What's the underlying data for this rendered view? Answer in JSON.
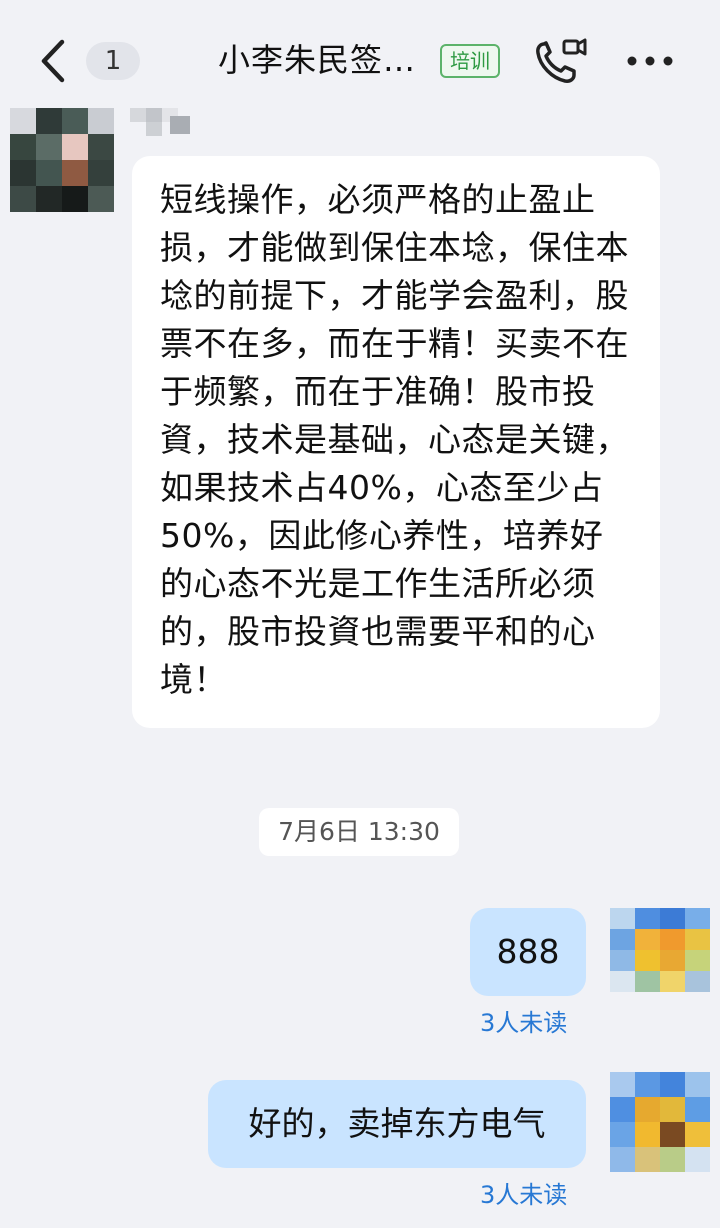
{
  "header": {
    "unread_count": "1",
    "title": "小李朱民签…",
    "tag": "培训"
  },
  "messages": {
    "incoming_text": "短线操作，必须严格的止盈止损，才能做到保住本埝，保住本埝的前提下，才能学会盈利，股票不在多，而在于精！买卖不在于频繁，而在于准确！股市投資，技术是基础，心态是关键，如果技术占40%，心态至少占50%，因此修心养性，培养好的心态不光是工作生活所必须的，股市投資也需要平和的心境！",
    "timestamp": "7月6日 13:30",
    "outgoing": [
      {
        "text": "888",
        "status": "3人未读"
      },
      {
        "text": "好的，卖掉东方电气",
        "status": "3人未读"
      }
    ]
  },
  "icons": {
    "back": "chevron-left-icon",
    "call": "video-call-icon",
    "more": "more-dots-icon"
  },
  "colors": {
    "background": "#f1f2f6",
    "incoming_bubble": "#ffffff",
    "outgoing_bubble": "#c9e4ff",
    "read_status": "#2778d4",
    "tag": "#2e9a43"
  }
}
